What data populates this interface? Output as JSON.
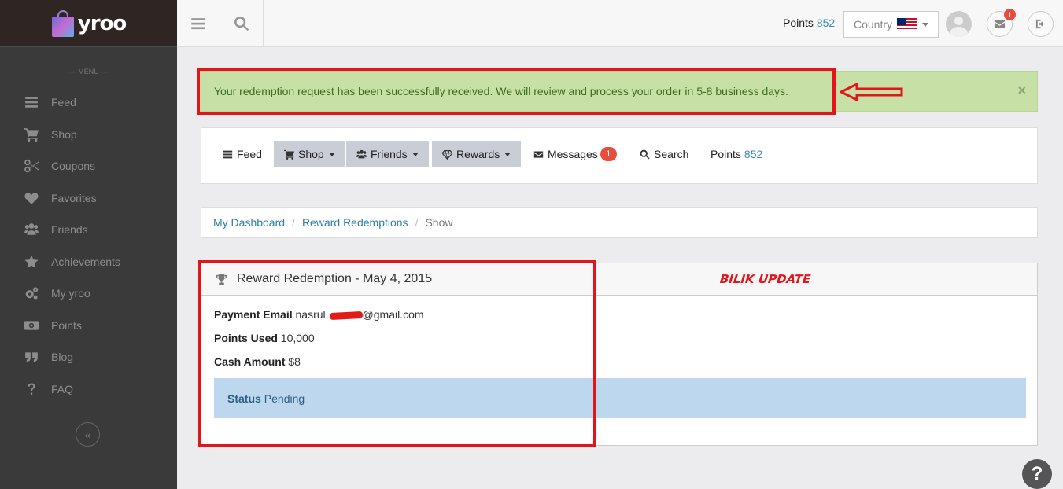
{
  "app": {
    "name": "yroo"
  },
  "sidebar": {
    "menu_label": "— MENU —",
    "items": [
      {
        "label": "Feed",
        "icon": "list-icon"
      },
      {
        "label": "Shop",
        "icon": "cart-icon"
      },
      {
        "label": "Coupons",
        "icon": "scissors-icon"
      },
      {
        "label": "Favorites",
        "icon": "heart-icon"
      },
      {
        "label": "Friends",
        "icon": "users-icon"
      },
      {
        "label": "Achievements",
        "icon": "star-icon"
      },
      {
        "label": "My yroo",
        "icon": "gears-icon"
      },
      {
        "label": "Points",
        "icon": "money-icon"
      },
      {
        "label": "Blog",
        "icon": "quote-icon"
      },
      {
        "label": "FAQ",
        "icon": "question-icon"
      }
    ],
    "collapse_icon": "«"
  },
  "header": {
    "points_label": "Points",
    "points_value": "852",
    "country_label": "Country",
    "notification_count": "1"
  },
  "alert": {
    "message": "Your redemption request has been successfully received. We will review and process your order in 5-8 business days.",
    "close": "×"
  },
  "nav": {
    "feed": "Feed",
    "shop": "Shop",
    "friends": "Friends",
    "rewards": "Rewards",
    "messages": "Messages",
    "messages_count": "1",
    "search": "Search",
    "points_label": "Points",
    "points_value": "852"
  },
  "breadcrumb": {
    "items": [
      "My Dashboard",
      "Reward Redemptions"
    ],
    "current": "Show",
    "separator": "/"
  },
  "redemption": {
    "title": "Reward Redemption - May 4, 2015",
    "payment_email_label": "Payment Email",
    "payment_email_prefix": "nasrul.",
    "payment_email_suffix": "@gmail.com",
    "points_used_label": "Points Used",
    "points_used_value": "10,000",
    "cash_amount_label": "Cash Amount",
    "cash_amount_value": "$8",
    "status_label": "Status",
    "status_value": "Pending"
  },
  "annotation": {
    "text": "BILIK UPDATE",
    "color": "#e4141b"
  },
  "help": {
    "label": "?"
  },
  "colors": {
    "accent": "#3a8cb5",
    "badge": "#e74c3c",
    "alert_bg": "#c7e0a6",
    "status_bg": "#bcd7ee"
  }
}
